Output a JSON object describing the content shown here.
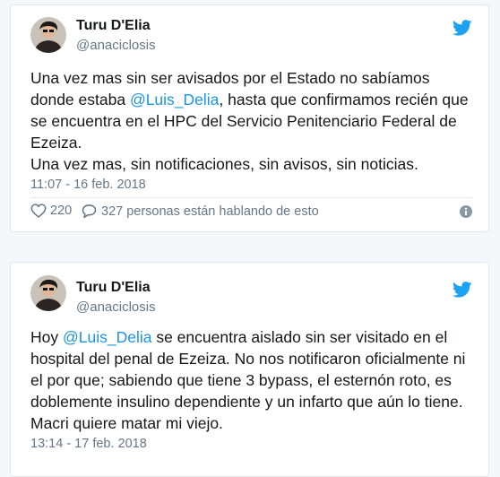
{
  "tweets": [
    {
      "display_name": "Turu D'Elia",
      "handle": "@anaciclosis",
      "text_lines": [
        [
          {
            "t": "Una vez mas sin ser avisados por el Estado no sabíamos"
          }
        ],
        [
          {
            "t": "donde estaba "
          },
          {
            "t": "@Luis_Delia",
            "mention": true
          },
          {
            "t": ", hasta que confirmamos recién que"
          }
        ],
        [
          {
            "t": "se encuentra en el HPC del Servicio Penitenciario Federal de"
          }
        ],
        [
          {
            "t": "Ezeiza."
          }
        ],
        [
          {
            "t": "Una vez mas, sin notificaciones, sin avisos, sin noticias."
          }
        ]
      ],
      "timestamp": "11:07 - 16 feb. 2018",
      "likes": "220",
      "replies_text": "327 personas están hablando de esto"
    },
    {
      "display_name": "Turu D'Elia",
      "handle": "@anaciclosis",
      "text_lines": [
        [
          {
            "t": "Hoy "
          },
          {
            "t": "@Luis_Delia",
            "mention": true
          },
          {
            "t": " se encuentra aislado sin ser visitado en el"
          }
        ],
        [
          {
            "t": "hospital del penal de Ezeiza. No nos notificaron oficialmente ni"
          }
        ],
        [
          {
            "t": "el por que; sabiendo que tiene 3 bypass, el esternón roto, es"
          }
        ],
        [
          {
            "t": "doblemente insulino dependiente y un infarto que aún lo tiene."
          }
        ],
        [
          {
            "t": "Macri quiere matar mi viejo."
          }
        ]
      ],
      "timestamp": "13:14 - 17 feb. 2018"
    }
  ],
  "icons": {
    "brand": "twitter-bird-icon",
    "like": "heart-icon",
    "reply": "speech-bubble-icon",
    "info": "info-icon"
  },
  "colors": {
    "brand_blue": "#1da1f2",
    "mention_blue": "#1b95e0",
    "text": "#14171a",
    "muted": "#657786"
  }
}
